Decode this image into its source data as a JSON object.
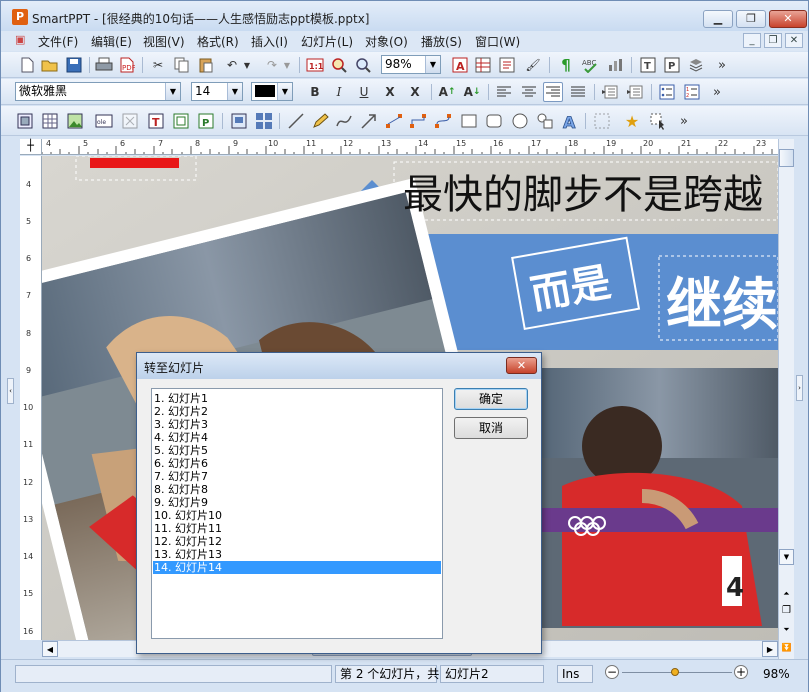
{
  "window": {
    "title": "SmartPPT - [很经典的10句话——人生感悟励志ppt模板.pptx]",
    "icon_letter": "P"
  },
  "menu": [
    "文件(F)",
    "编辑(E)",
    "视图(V)",
    "格式(R)",
    "插入(I)",
    "幻灯片(L)",
    "对象(O)",
    "播放(S)",
    "窗口(W)"
  ],
  "toolbar": {
    "zoom": "98%",
    "font_name": "微软雅黑",
    "font_size": "14"
  },
  "slide": {
    "heading": "最快的脚步不是跨越",
    "tag1": "而是",
    "tag2": "继续",
    "accent": "#5b8ed0"
  },
  "dialog": {
    "title": "转至幻灯片",
    "items": [
      "1. 幻灯片1",
      "2. 幻灯片2",
      "3. 幻灯片3",
      "4. 幻灯片4",
      "5. 幻灯片5",
      "6. 幻灯片6",
      "7. 幻灯片7",
      "8. 幻灯片8",
      "9. 幻灯片9",
      "10. 幻灯片10",
      "11. 幻灯片11",
      "12. 幻灯片12",
      "13. 幻灯片13",
      "14. 幻灯片14"
    ],
    "selected_index": 13,
    "ok_label": "确定",
    "cancel_label": "取消"
  },
  "ruler": {
    "h_ticks": [
      "4",
      "5",
      "6",
      "7",
      "8",
      "9",
      "10",
      "11",
      "12",
      "13",
      "14",
      "15",
      "16",
      "17",
      "18",
      "19",
      "20",
      "21",
      "22",
      "23"
    ],
    "v_ticks": [
      "4",
      "5",
      "6",
      "7",
      "8",
      "9",
      "10",
      "11",
      "12",
      "13",
      "14",
      "15",
      "16"
    ]
  },
  "status": {
    "slide_info": "第 2 个幻灯片，共",
    "slide_name": "幻灯片2",
    "mode": "Ins",
    "zoom": "98%"
  }
}
